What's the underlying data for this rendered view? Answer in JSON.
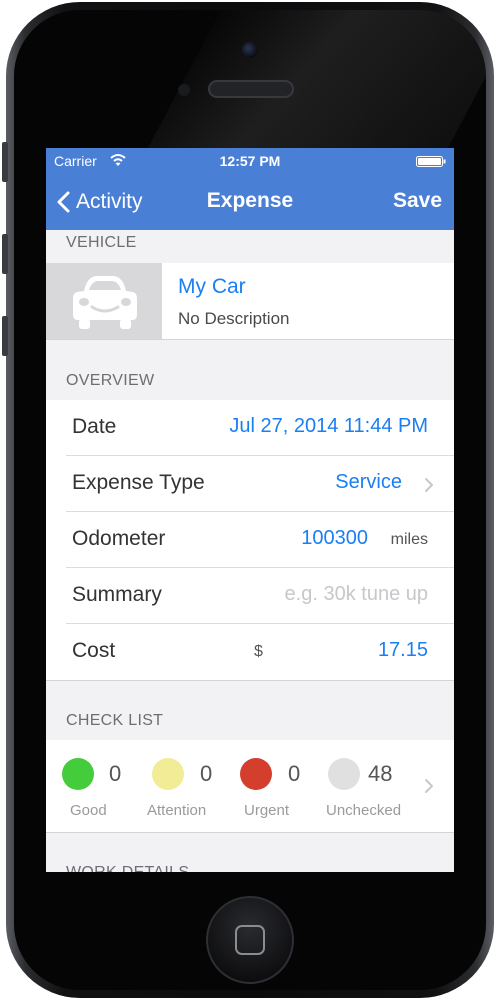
{
  "status_bar": {
    "carrier": "Carrier",
    "time": "12:57 PM"
  },
  "nav": {
    "back_label": "Activity",
    "title": "Expense",
    "save_label": "Save"
  },
  "sections": {
    "vehicle": "VEHICLE",
    "overview": "OVERVIEW",
    "checklist": "CHECK LIST",
    "work_details": "WORK DETAILS"
  },
  "vehicle": {
    "name": "My Car",
    "description": "No Description",
    "icon": "car-icon"
  },
  "overview": {
    "date": {
      "label": "Date",
      "value": "Jul 27, 2014 11:44 PM"
    },
    "expense_type": {
      "label": "Expense Type",
      "value": "Service"
    },
    "odometer": {
      "label": "Odometer",
      "value": "100300",
      "unit": "miles"
    },
    "summary": {
      "label": "Summary",
      "placeholder": "e.g. 30k tune up"
    },
    "cost": {
      "label": "Cost",
      "currency": "$",
      "value": "17.15"
    }
  },
  "checklist": [
    {
      "label": "Good",
      "count": "0",
      "color": "#44cc3c"
    },
    {
      "label": "Attention",
      "count": "0",
      "color": "#f2ec96"
    },
    {
      "label": "Urgent",
      "count": "0",
      "color": "#d43e2c"
    },
    {
      "label": "Unchecked",
      "count": "48",
      "color": "#e0e0e0"
    }
  ],
  "colors": {
    "nav_bar": "#4a7fd6",
    "accent": "#1a7ff2"
  }
}
